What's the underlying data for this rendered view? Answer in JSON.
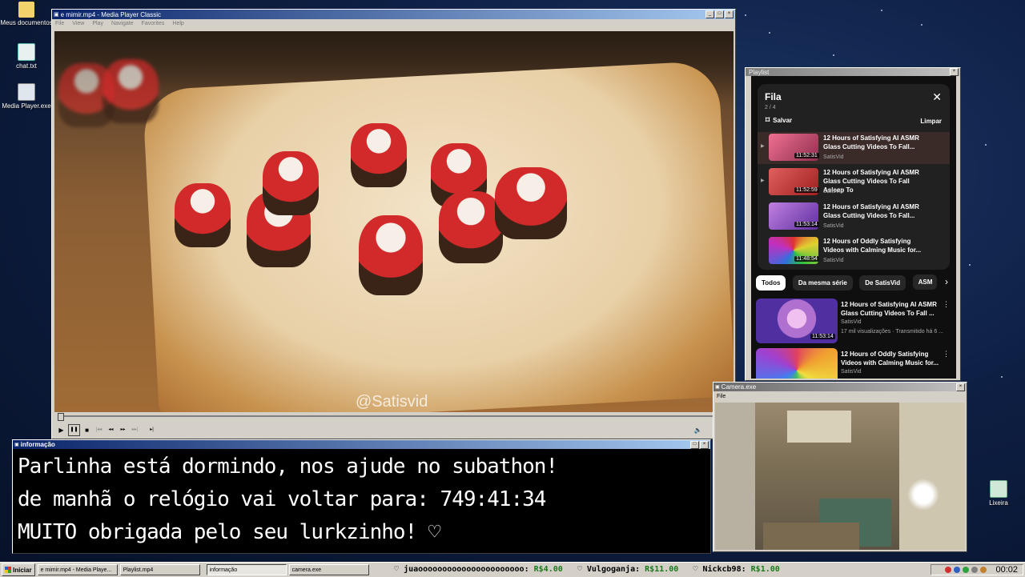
{
  "desktop_icons": [
    {
      "label": "Meus documentos",
      "icon": "folder-icon"
    },
    {
      "label": "chat.txt",
      "icon": "text-file-icon"
    },
    {
      "label": "Media Player.exe",
      "icon": "media-player-icon"
    },
    {
      "label": "Lixeira",
      "icon": "recycle-bin-icon"
    }
  ],
  "player": {
    "title": "e mimir.mp4 - Media Player Classic",
    "menu": [
      "File",
      "View",
      "Play",
      "Navigate",
      "Favorites",
      "Help"
    ],
    "watermark": "@Satisvid",
    "control_glyphs": [
      "▶",
      "❚❚",
      "■",
      "|◂◂",
      "◂◂",
      "▸▸",
      "▸▸|",
      "▸|"
    ]
  },
  "info": {
    "title": "informação",
    "lines": [
      "Parlinha está dormindo, nos ajude no subathon!",
      "de manhã o relógio vai voltar para:  749:41:34",
      "MUITO obrigada pelo seu lurkzinho! ♡"
    ]
  },
  "playlist": {
    "title": "Playlist",
    "queue_title": "Fila",
    "position": "2 / 4",
    "save": "Salvar",
    "clear": "Limpar",
    "queue": [
      {
        "title": "12 Hours of Satisfying AI ASMR Glass Cutting Videos To Fall...",
        "duration": "11:52:31",
        "channel": "SatisVid",
        "color": "#c0407a"
      },
      {
        "title": "12 Hours of Satisfying AI ASMR Glass Cutting Videos To Fall Asleep To",
        "duration": "11:52:59",
        "channel": "SatisVid",
        "color": "#d04a4a"
      },
      {
        "title": "12 Hours of Satisfying AI ASMR Glass Cutting Videos To Fall...",
        "duration": "11:53:14",
        "channel": "SatisVid",
        "color": "#a060c0"
      },
      {
        "title": "12 Hours of Oddly Satisfying Videos with Calming Music for...",
        "duration": "11:48:54",
        "channel": "SatisVid",
        "color": "#40a060"
      }
    ],
    "chips": [
      "Todos",
      "Da mesma série",
      "De SatisVid",
      "ASM"
    ],
    "recommended": [
      {
        "title": "12 Hours of Satisfying AI ASMR Glass Cutting Videos To Fall ...",
        "channel": "SatisVid",
        "meta": "17 mil visualizações · Transmitido há 6 ...",
        "duration": "11:53:14",
        "color": "#b070d0"
      },
      {
        "title": "12 Hours of Oddly Satisfying Videos with Calming Music for...",
        "channel": "SatisVid",
        "meta": "",
        "duration": "",
        "color": "#e04060"
      }
    ]
  },
  "camera": {
    "title": "Camera.exe",
    "menu": [
      "File"
    ]
  },
  "taskbar": {
    "start": "Iniciar",
    "tasks": [
      {
        "label": "e mimir.mp4 - Media Playe..."
      },
      {
        "label": "Playlist.mp4"
      },
      {
        "label": "informação"
      },
      {
        "label": "camera.exe"
      }
    ],
    "ticker": [
      {
        "name": "juaoooooooooooooooooooooo:",
        "amount": "R$4.00"
      },
      {
        "name": "Vulgoganja:",
        "amount": "R$11.00"
      },
      {
        "name": "Nickcb98:",
        "amount": "R$1.00"
      }
    ],
    "clock": "00:02"
  }
}
